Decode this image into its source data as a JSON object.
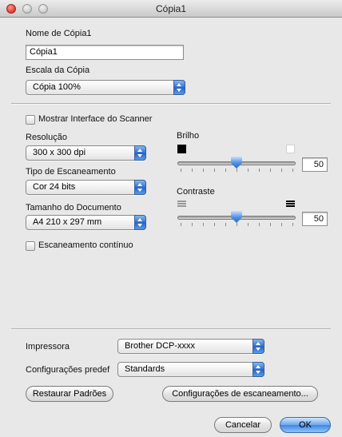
{
  "window": {
    "title": "Cópia1"
  },
  "copy_name": {
    "label": "Nome de Cópia1",
    "value": "Cópia1"
  },
  "copy_scale": {
    "label": "Escala da Cópia",
    "selected": "Cópia 100%"
  },
  "scanner_interface": {
    "label": "Mostrar Interface do Scanner",
    "checked": false
  },
  "resolution": {
    "label": "Resolução",
    "selected": "300 x 300 dpi"
  },
  "scan_type": {
    "label": "Tipo de Escaneamento",
    "selected": "Cor 24 bits"
  },
  "document_size": {
    "label": "Tamanho do Documento",
    "selected": "A4 210 x 297 mm"
  },
  "continuous_scan": {
    "label": "Escaneamento contínuo",
    "checked": false
  },
  "brightness": {
    "label": "Brilho",
    "value": "50",
    "level": 0.5
  },
  "contrast": {
    "label": "Contraste",
    "value": "50",
    "level": 0.5
  },
  "printer": {
    "label": "Impressora",
    "selected": "Brother DCP-xxxx"
  },
  "presets": {
    "label": "Configurações predef",
    "selected": "Standards"
  },
  "buttons": {
    "restore": "Restaurar Padrões",
    "scan_settings": "Configurações de escaneamento...",
    "cancel": "Cancelar",
    "ok": "OK"
  },
  "colors": {
    "accent": "#3f86e3",
    "window_bg": "#e8e8e8"
  }
}
